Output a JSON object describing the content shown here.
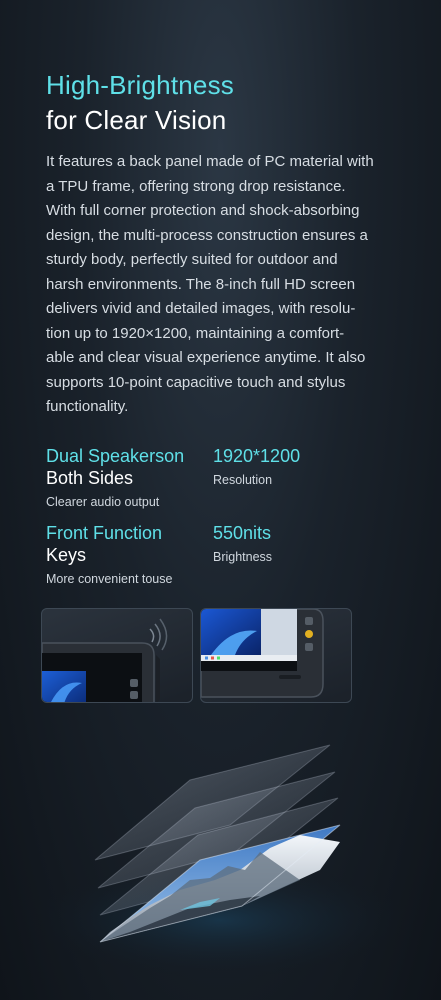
{
  "heading": {
    "line1": "High-Brightness",
    "line2": "for Clear Vision"
  },
  "description": "It features a back panel made of PC material with\na TPU frame, offering strong drop resistance.\nWith full corner protection and shock-absorbing\ndesign, the multi-process construction ensures a\nsturdy body, perfectly suited for outdoor and\nharsh environments. The 8-inch full HD screen\ndelivers vivid and detailed images, with resolu-\ntion up to 1920×1200, maintaining a comfort-\nable and clear visual experience anytime. It also\nsupports 10-point capacitive touch and stylus\nfunctionality.",
  "features": [
    {
      "title_accent": "Dual Speakerson",
      "title_white": "Both Sides",
      "caption": "Clearer audio output"
    },
    {
      "title_accent": "1920*1200",
      "caption": "Resolution"
    },
    {
      "title_accent": "Front Function",
      "title_white": "Keys",
      "caption": "More convenient touse"
    },
    {
      "title_accent": "550nits",
      "caption": "Brightness"
    }
  ],
  "colors": {
    "accent": "#5fe0e8",
    "background": "#1a222b"
  },
  "images": {
    "thumb1": "tablet-corner-speaker-photo",
    "thumb2": "tablet-front-keys-photo",
    "hero": "layered-screen-mountain-illustration"
  }
}
